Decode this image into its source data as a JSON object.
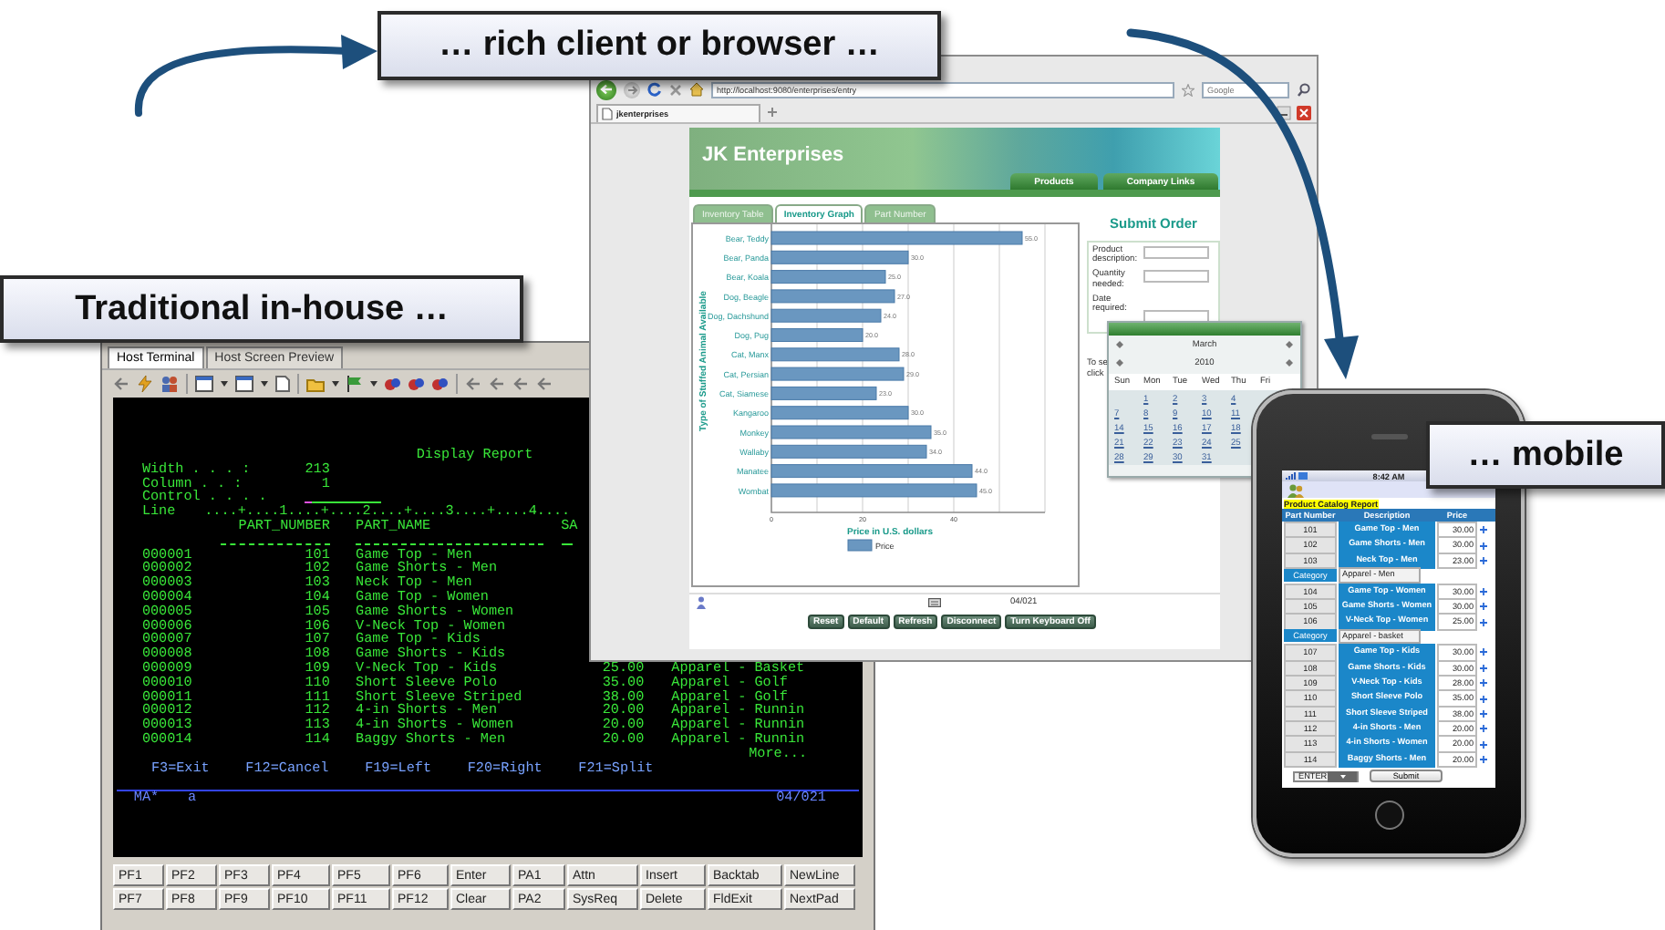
{
  "callouts": [
    {
      "text": "… rich client or browser …"
    },
    {
      "text": "Traditional in-house …"
    },
    {
      "text": "… mobile"
    }
  ],
  "terminal": {
    "tabs": [
      {
        "label": "Host Terminal",
        "selected": true
      },
      {
        "label": "Host Screen Preview",
        "selected": false
      }
    ],
    "screen": {
      "title": "Display Report",
      "fields": [
        {
          "label": "Width . . . :",
          "value": "213"
        },
        {
          "label": "Column . . :",
          "value": "1"
        }
      ],
      "control_label": "Control . . . .",
      "ruler_label": "Line",
      "ruler": "....+....1....+....2....+....3....+....4....",
      "headers": [
        "PART_NUMBER",
        "PART_NAME",
        "SA"
      ],
      "rows": [
        {
          "seq": "000001",
          "part": "101",
          "name": "Game Top - Men"
        },
        {
          "seq": "000002",
          "part": "102",
          "name": "Game Shorts - Men"
        },
        {
          "seq": "000003",
          "part": "103",
          "name": "Neck Top - Men"
        },
        {
          "seq": "000004",
          "part": "104",
          "name": "Game Top - Women"
        },
        {
          "seq": "000005",
          "part": "105",
          "name": "Game Shorts - Women"
        },
        {
          "seq": "000006",
          "part": "106",
          "name": "V-Neck Top - Women"
        },
        {
          "seq": "000007",
          "part": "107",
          "name": "Game Top - Kids"
        },
        {
          "seq": "000008",
          "part": "108",
          "name": "Game Shorts - Kids"
        },
        {
          "seq": "000009",
          "part": "109",
          "name": "V-Neck Top - Kids",
          "price": "25.00",
          "category": "Apparel - Basket"
        },
        {
          "seq": "000010",
          "part": "110",
          "name": "Short Sleeve Polo",
          "price": "35.00",
          "category": "Apparel - Golf"
        },
        {
          "seq": "000011",
          "part": "111",
          "name": "Short Sleeve Striped",
          "price": "38.00",
          "category": "Apparel - Golf"
        },
        {
          "seq": "000012",
          "part": "112",
          "name": "4-in Shorts - Men",
          "price": "20.00",
          "category": "Apparel - Runnin"
        },
        {
          "seq": "000013",
          "part": "113",
          "name": "4-in Shorts - Women",
          "price": "20.00",
          "category": "Apparel - Runnin"
        },
        {
          "seq": "000014",
          "part": "114",
          "name": "Baggy Shorts - Men",
          "price": "20.00",
          "category": "Apparel - Runnin"
        }
      ],
      "more": "More...",
      "function_keys": [
        "F3=Exit",
        "F12=Cancel",
        "F19=Left",
        "F20=Right",
        "F21=Split"
      ],
      "status": {
        "mode": "MA*",
        "indicator": "a",
        "position": "04/021"
      }
    },
    "keys": [
      [
        "PF1",
        "PF2",
        "PF3",
        "PF4",
        "PF5",
        "PF6",
        "Enter",
        "PA1",
        "Attn",
        "Insert",
        "Backtab",
        "NewLine"
      ],
      [
        "PF7",
        "PF8",
        "PF9",
        "PF10",
        "PF11",
        "PF12",
        "Clear",
        "PA2",
        "SysReq",
        "Delete",
        "FldExit",
        "NextPad"
      ]
    ]
  },
  "browser": {
    "url": "http://localhost:9080/enterprises/entry",
    "search_placeholder": "Google",
    "tab": "jkenterprises",
    "page": {
      "title": "JK Enterprises",
      "nav": [
        "Products",
        "Company Links"
      ],
      "tabs": [
        {
          "label": "Inventory Table",
          "selected": false
        },
        {
          "label": "Inventory Graph",
          "selected": true
        },
        {
          "label": "Part Number",
          "selected": false
        }
      ],
      "chart_data": {
        "type": "bar",
        "orientation": "horizontal",
        "xlabel": "Price in U.S. dollars",
        "ylabel": "Type of Stuffed Animal Available",
        "categories": [
          "Bear, Teddy",
          "Bear, Panda",
          "Bear, Koala",
          "Dog, Beagle",
          "Dog, Dachshund",
          "Dog, Pug",
          "Cat, Manx",
          "Cat, Persian",
          "Cat, Siamese",
          "Kangaroo",
          "Monkey",
          "Wallaby",
          "Manatee",
          "Wombat"
        ],
        "series": [
          {
            "name": "Price",
            "color": "#6a97c0",
            "values": [
              55,
              30,
              25,
              27,
              24,
              20,
              28,
              29,
              23,
              30,
              35,
              34,
              44,
              45
            ]
          }
        ],
        "xlim": [
          0,
          60
        ],
        "xticks": [
          0,
          20,
          40
        ],
        "value_labels": [
          "55.0",
          "30.0",
          "25.0",
          "27.0",
          "24.0",
          "20.0",
          "28.0",
          "29.0",
          "23.0",
          "30.0",
          "35.0",
          "34.0",
          "44.0",
          "45.0"
        ]
      },
      "order": {
        "title": "Submit Order",
        "fields": [
          {
            "label": "Product description:",
            "kind": "text"
          },
          {
            "label": "Quantity needed:",
            "kind": "text"
          },
          {
            "label": "Date required:",
            "kind": "date"
          }
        ],
        "hint_lines": [
          "To se",
          "click"
        ]
      },
      "position": "04/021",
      "buttons": [
        "Reset",
        "Default",
        "Refresh",
        "Disconnect",
        "Turn Keyboard Off"
      ]
    }
  },
  "calendar": {
    "month": "March",
    "year": "2010",
    "days": [
      "Sun",
      "Mon",
      "Tue",
      "Wed",
      "Thu",
      "Fri"
    ],
    "weeks": [
      [
        "1",
        "2",
        "3",
        "4"
      ],
      [
        "7",
        "8",
        "9",
        "10",
        "11"
      ],
      [
        "14",
        "15",
        "16",
        "17",
        "18"
      ],
      [
        "21",
        "22",
        "23",
        "24",
        "25"
      ],
      [
        "28",
        "29",
        "30",
        "31"
      ]
    ]
  },
  "phone": {
    "time": "8:42 AM",
    "report_title": "Product Catalog Report",
    "columns": [
      "Part Number",
      "Description",
      "Price"
    ],
    "rows": [
      {
        "kind": "item",
        "part": "101",
        "description": "Game Top - Men",
        "price": "30.00"
      },
      {
        "kind": "item",
        "part": "102",
        "description": "Game Shorts - Men",
        "price": "30.00"
      },
      {
        "kind": "item",
        "part": "103",
        "description": "Neck Top - Men",
        "price": "23.00"
      },
      {
        "kind": "category",
        "label": "Category",
        "value": "Apparel - Men"
      },
      {
        "kind": "item",
        "part": "104",
        "description": "Game Top - Women",
        "price": "30.00"
      },
      {
        "kind": "item",
        "part": "105",
        "description": "Game Shorts - Women",
        "price": "30.00"
      },
      {
        "kind": "item",
        "part": "106",
        "description": "V-Neck Top - Women",
        "price": "25.00"
      },
      {
        "kind": "category",
        "label": "Category",
        "value": "Apparel - basket"
      },
      {
        "kind": "item",
        "part": "107",
        "description": "Game Top - Kids",
        "price": "30.00"
      },
      {
        "kind": "item",
        "part": "108",
        "description": "Game Shorts - Kids",
        "price": "30.00"
      },
      {
        "kind": "item",
        "part": "109",
        "description": "V-Neck Top - Kids",
        "price": "28.00"
      },
      {
        "kind": "item",
        "part": "110",
        "description": "Short Sleeve Polo",
        "price": "35.00"
      },
      {
        "kind": "item",
        "part": "111",
        "description": "Short Sleeve Striped",
        "price": "38.00"
      },
      {
        "kind": "item",
        "part": "112",
        "description": "4-in Shorts - Men",
        "price": "20.00"
      },
      {
        "kind": "item",
        "part": "113",
        "description": "4-in Shorts - Women",
        "price": "20.00"
      },
      {
        "kind": "item",
        "part": "114",
        "description": "Baggy Shorts - Men",
        "price": "20.00"
      }
    ],
    "action": "ENTER",
    "submit": "Submit"
  }
}
